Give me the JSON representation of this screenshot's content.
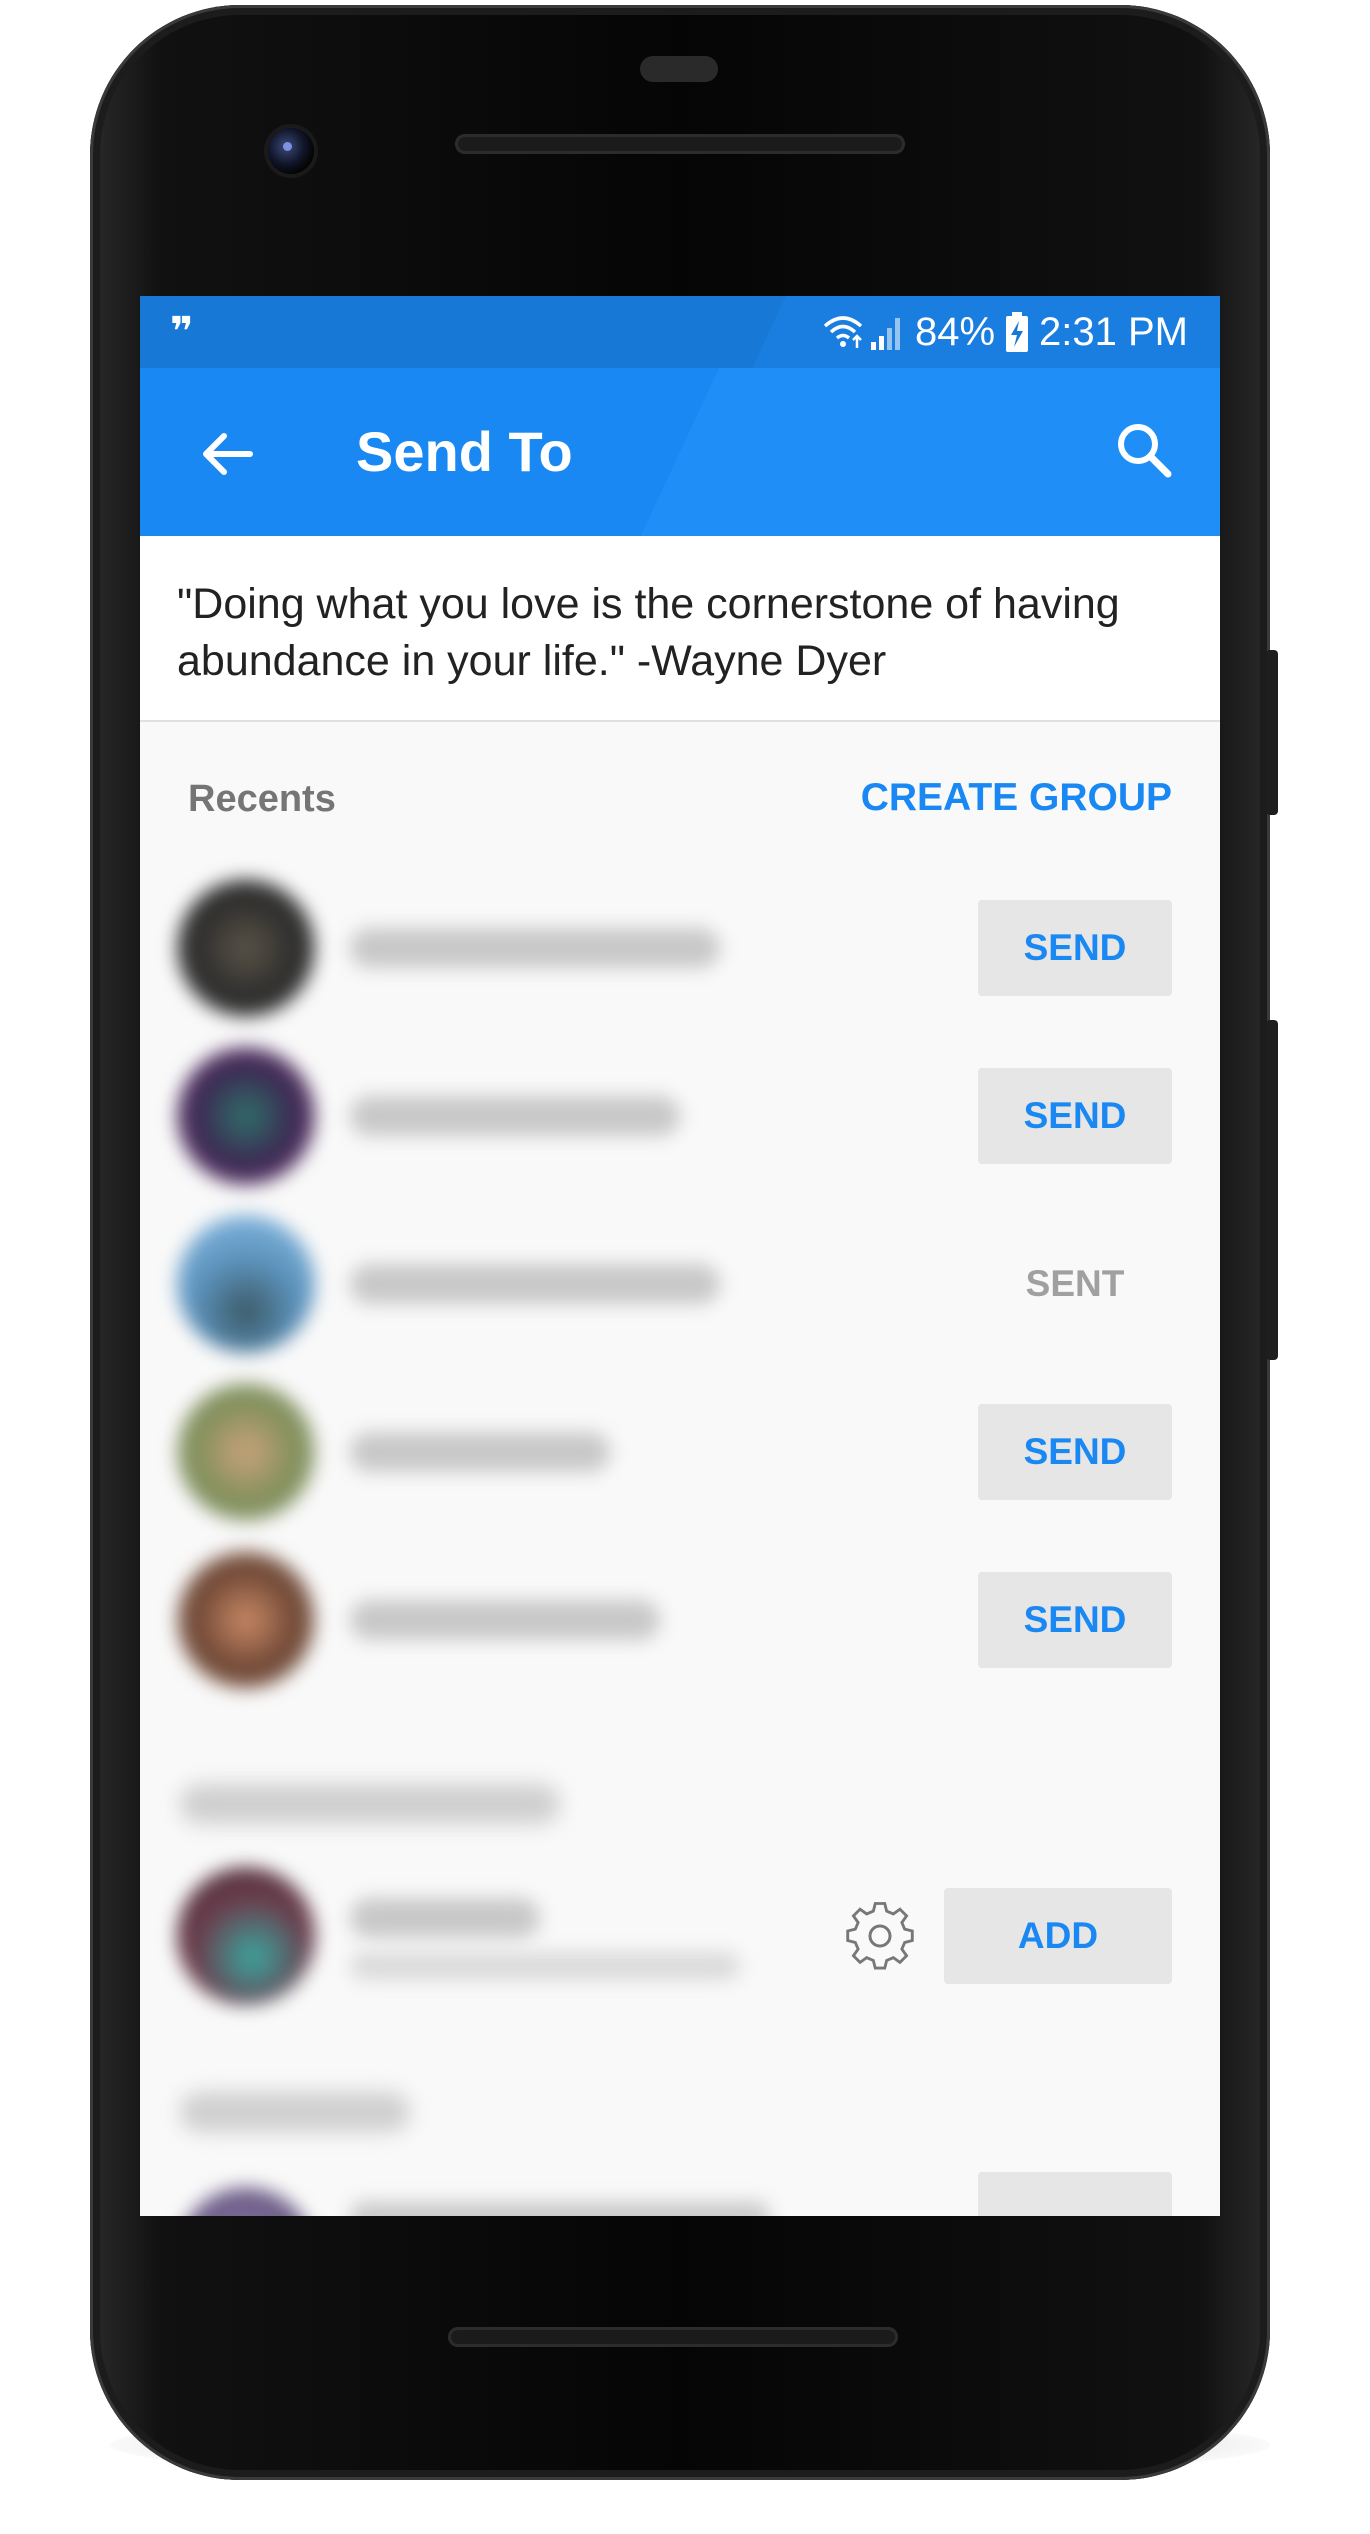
{
  "status_bar": {
    "notification_icon": "quote-icon",
    "notification_glyph": "❞",
    "battery_percent": "84%",
    "time": "2:31 PM",
    "icons": [
      "wifi-icon",
      "signal-icon",
      "battery-charging-icon"
    ]
  },
  "app_bar": {
    "title": "Send To",
    "back_icon": "arrow-left-icon",
    "search_icon": "search-icon",
    "color": "#1a88f2"
  },
  "quote": {
    "text": "\"Doing what you love is the cornerstone of having abundance in your life.\" -Wayne Dyer"
  },
  "recents": {
    "label": "Recents",
    "create_group_label": "CREATE GROUP",
    "contacts": [
      {
        "action_label": "SEND",
        "state": "send"
      },
      {
        "action_label": "SEND",
        "state": "send"
      },
      {
        "action_label": "SENT",
        "state": "sent"
      },
      {
        "action_label": "SEND",
        "state": "send"
      },
      {
        "action_label": "SEND",
        "state": "send"
      }
    ]
  },
  "suggested": {
    "contacts": [
      {
        "action_label": "ADD",
        "settings_icon": "gear-icon"
      }
    ]
  },
  "colors": {
    "accent": "#1a88f2",
    "status_bar": "#1778d6",
    "button_bg": "#e6e6e6",
    "sent_text": "#a0a0a0"
  }
}
